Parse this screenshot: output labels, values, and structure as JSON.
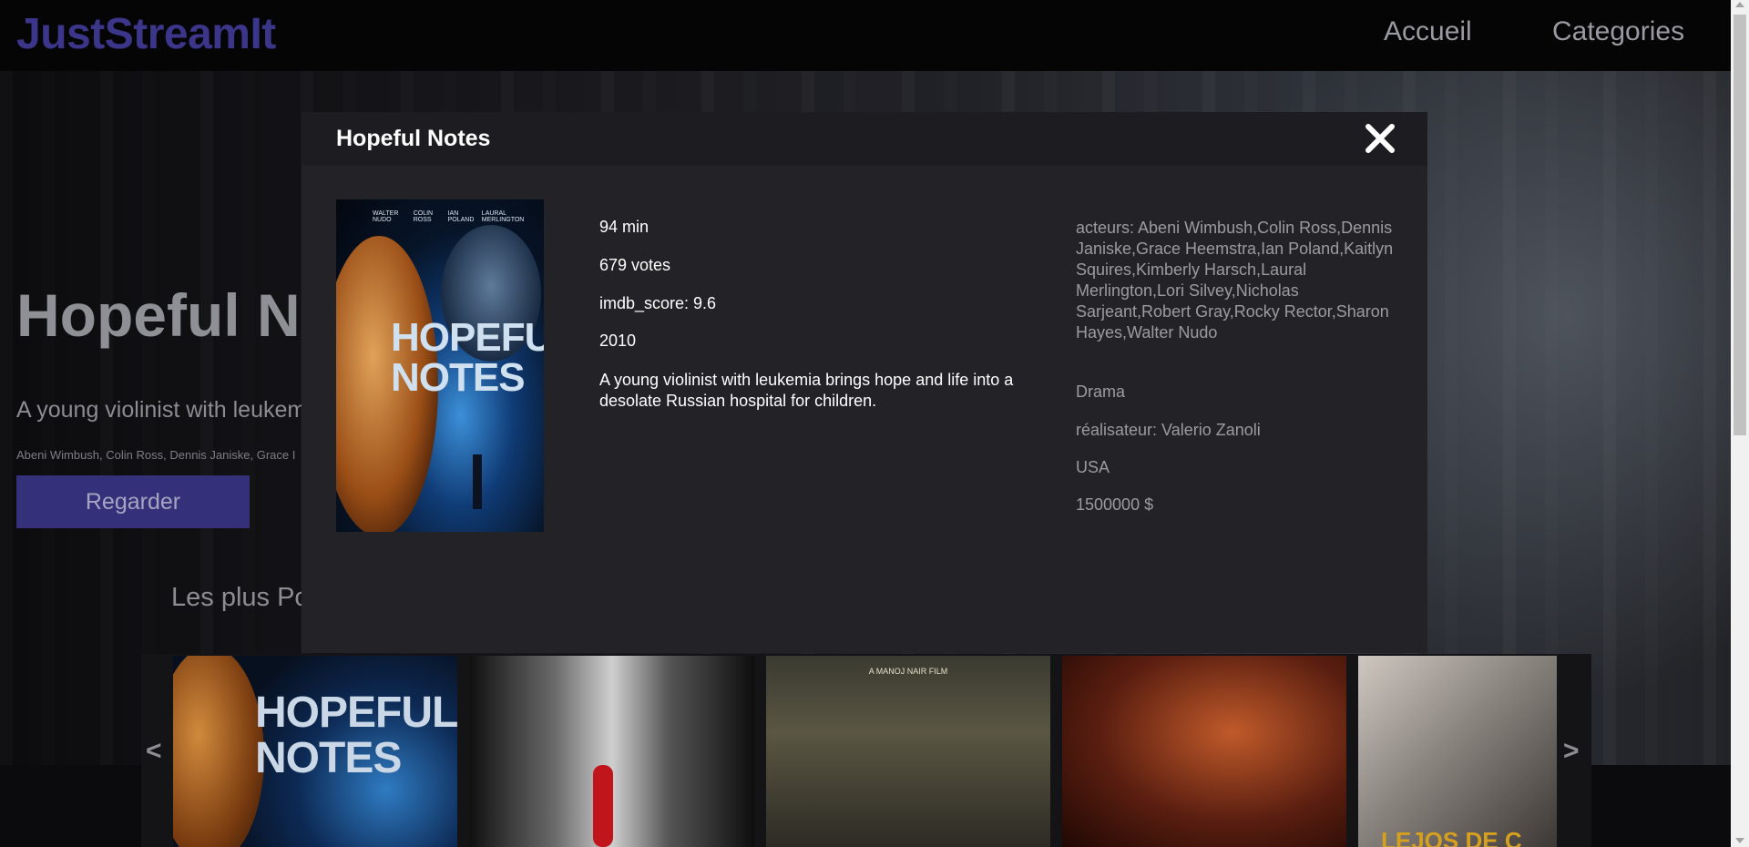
{
  "header": {
    "logo": "JustStreamIt",
    "nav": {
      "home": "Accueil",
      "categories": "Categories"
    }
  },
  "hero": {
    "title": "Hopeful No",
    "description": "A young violinist with leukem",
    "cast": "Abeni Wimbush, Colin Ross, Dennis Janiske, Grace I",
    "button": "Regarder"
  },
  "section": {
    "title": "Les plus Po"
  },
  "carousel": {
    "prev": "<",
    "next": ">",
    "thumb1": {
      "line1": "HOPEFUL",
      "line2": "NOTES"
    },
    "thumb3_caption": "A MANOJ NAIR FILM",
    "thumb5_text": "LEJOS DE C"
  },
  "modal": {
    "title": "Hopeful Notes",
    "poster": {
      "names": [
        "WALTER NUDO",
        "COLIN ROSS",
        "IAN POLAND",
        "LAURAL MERLINGTON"
      ],
      "line1": "HOPEFUL",
      "line2": "NOTES"
    },
    "duration": "94 min",
    "votes": "679 votes",
    "imdb_score": "imdb_score: 9.6",
    "year": "2010",
    "description": "A young violinist with leukemia brings hope and life into a desolate Russian hospital for children.",
    "actors": "acteurs: Abeni Wimbush,Colin Ross,Dennis Janiske,Grace Heemstra,Ian Poland,Kaitlyn Squires,Kimberly Harsch,Laural Merlington,Lori Silvey,Nicholas Sarjeant,Robert Gray,Rocky Rector,Sharon Hayes,Walter Nudo",
    "genre": "Drama",
    "director": "réalisateur: Valerio Zanoli",
    "country": "USA",
    "budget": "1500000 $"
  },
  "icons": {
    "close": "close-icon"
  },
  "colors": {
    "brand": "#3b3689",
    "button": "#34307a",
    "modal_bg": "#232226"
  }
}
